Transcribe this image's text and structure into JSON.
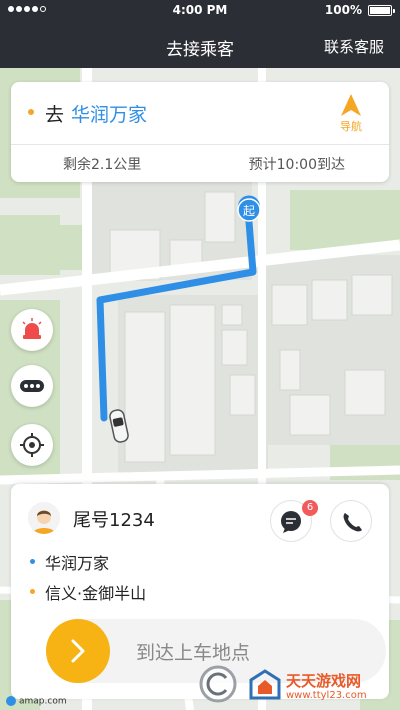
{
  "status_bar": {
    "time": "4:00 PM",
    "battery": "100%"
  },
  "nav": {
    "title": "去接乘客",
    "right_link": "联系客服"
  },
  "route": {
    "prefix": "去",
    "destination": "华润万家",
    "nav_label": "导航",
    "distance": "剩余2.1公里",
    "eta": "预计10:00到达"
  },
  "map": {
    "start_marker": "起",
    "route_color": "#2f8fe6",
    "map_buttons": [
      "alarm-icon",
      "more-icon",
      "locate-icon"
    ]
  },
  "passenger": {
    "tail_number": "尾号1234",
    "message_count": "6",
    "pickup": "华润万家",
    "dropoff": "信义·金御半山",
    "pickup_dot_color": "#2f8fe6",
    "dropoff_dot_color": "#f5a623"
  },
  "action": {
    "slider_label": "到达上车地点",
    "accent": "#f7b314"
  },
  "footer": {
    "amap": "amap.com",
    "watermark_title": "天天游戏网",
    "watermark_url": "www.ttyl23.com"
  }
}
